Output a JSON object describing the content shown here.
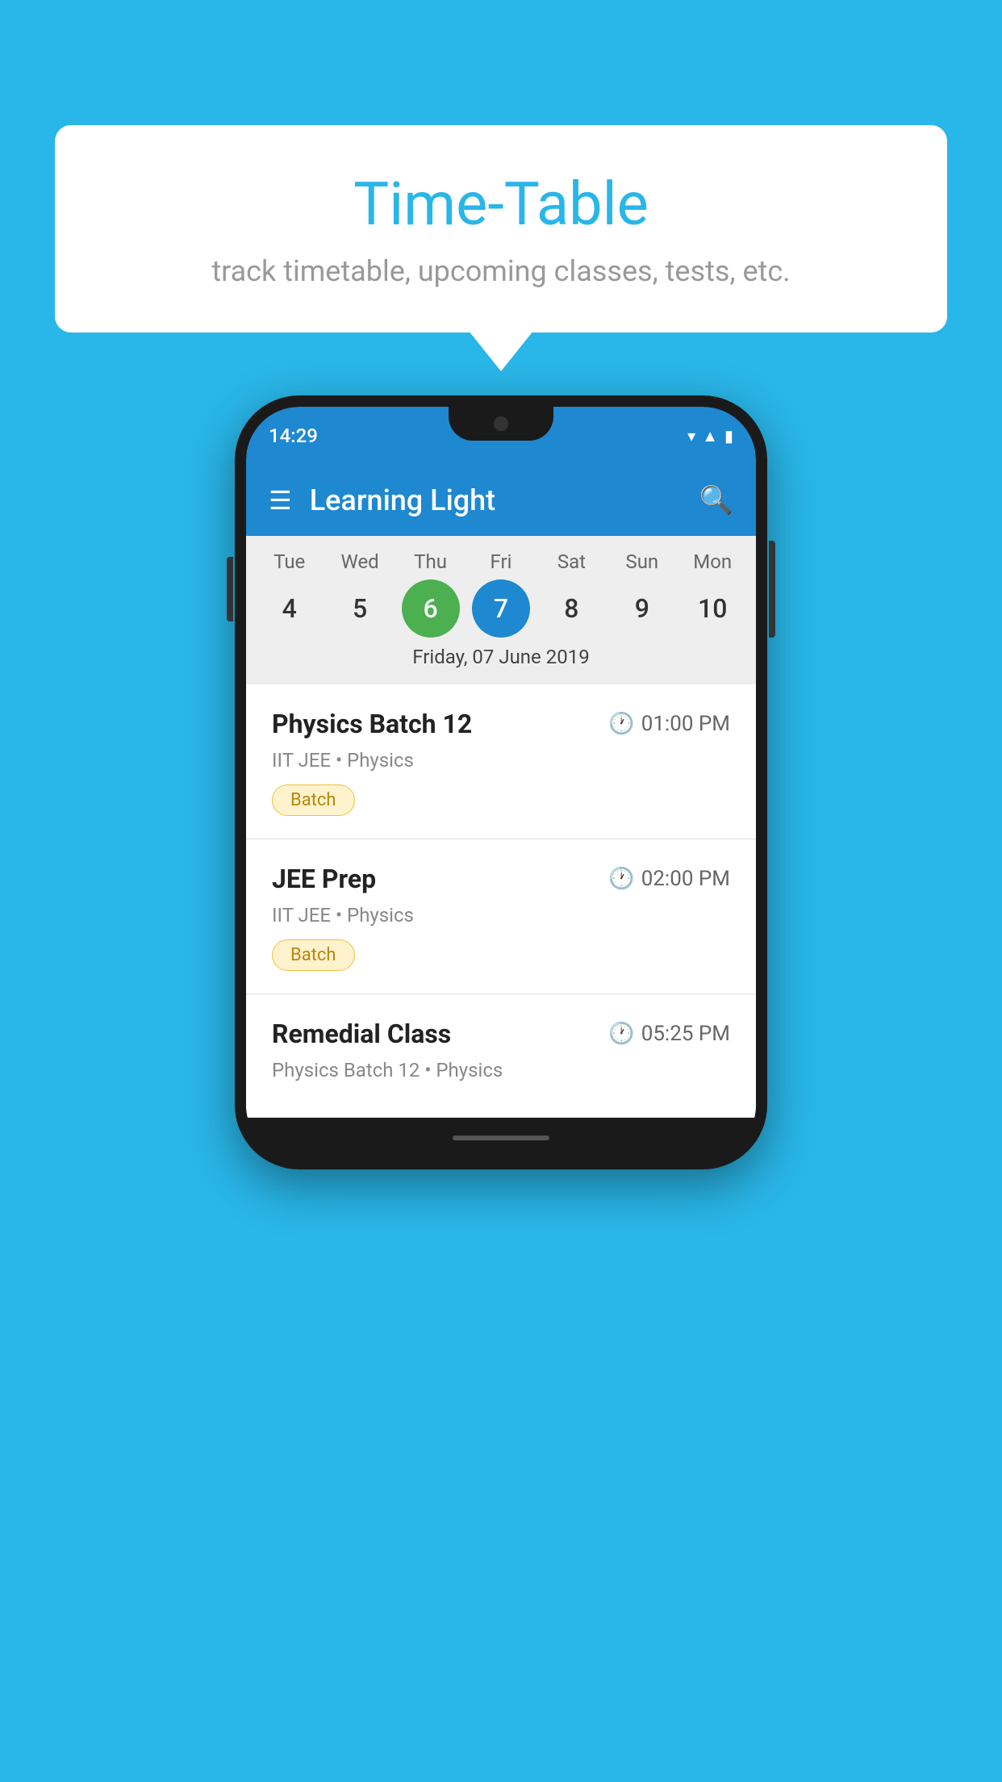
{
  "background_color": "#29b6e8",
  "speech_bubble": {
    "title": "Time-Table",
    "subtitle": "track timetable, upcoming classes, tests, etc."
  },
  "phone": {
    "status_bar": {
      "time": "14:29"
    },
    "app_bar": {
      "title": "Learning Light"
    },
    "calendar": {
      "days": [
        "Tue",
        "Wed",
        "Thu",
        "Fri",
        "Sat",
        "Sun",
        "Mon"
      ],
      "dates": [
        "4",
        "5",
        "6",
        "7",
        "8",
        "9",
        "10"
      ],
      "today_index": 2,
      "selected_index": 3,
      "selected_label": "Friday, 07 June 2019"
    },
    "schedule": [
      {
        "title": "Physics Batch 12",
        "time": "01:00 PM",
        "subtitle": "IIT JEE • Physics",
        "tag": "Batch"
      },
      {
        "title": "JEE Prep",
        "time": "02:00 PM",
        "subtitle": "IIT JEE • Physics",
        "tag": "Batch"
      },
      {
        "title": "Remedial Class",
        "time": "05:25 PM",
        "subtitle": "Physics Batch 12 • Physics",
        "tag": null
      }
    ]
  }
}
